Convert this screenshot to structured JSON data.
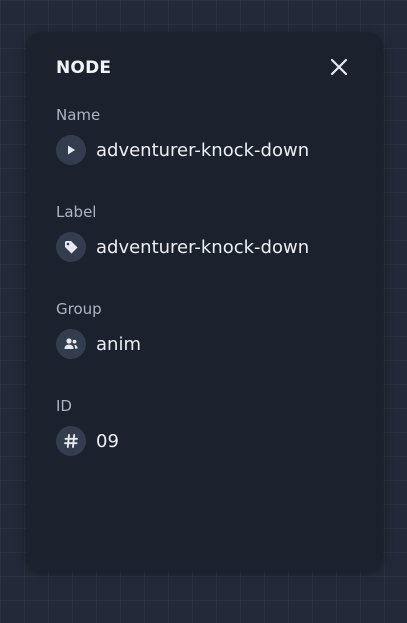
{
  "panel": {
    "title": "NODE",
    "close_icon": "close-icon",
    "fields": [
      {
        "label": "Name",
        "value": "adventurer-knock-down",
        "icon": "play-icon"
      },
      {
        "label": "Label",
        "value": "adventurer-knock-down",
        "icon": "tag-icon"
      },
      {
        "label": "Group",
        "value": "anim",
        "icon": "users-icon"
      },
      {
        "label": "ID",
        "value": "09",
        "icon": "hash-icon"
      }
    ]
  },
  "colors": {
    "background": "#222a39",
    "panel": "#1b212d",
    "icon_circle": "#343d4e",
    "label_text": "#aeb5c2",
    "value_text": "#eceff4"
  }
}
